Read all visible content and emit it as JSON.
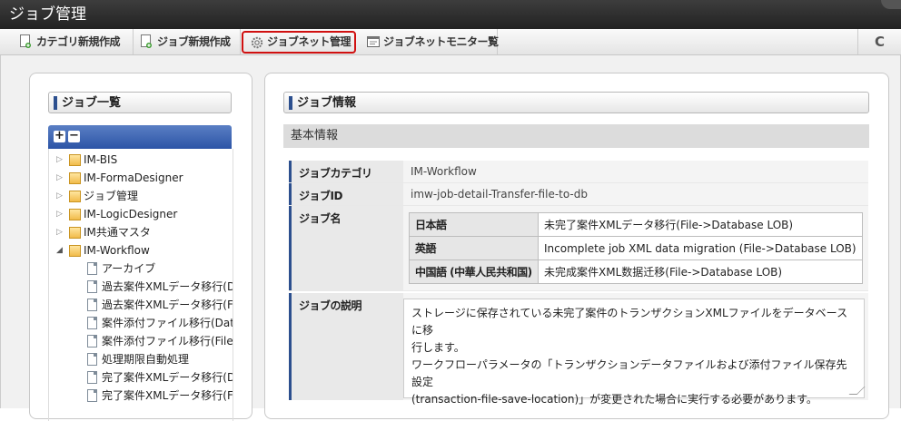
{
  "window": {
    "title": "ジョブ管理"
  },
  "toolbar": {
    "buttons": [
      {
        "label": "カテゴリ新規作成",
        "icon": "document-add-icon"
      },
      {
        "label": "ジョブ新規作成",
        "icon": "document-add-icon"
      },
      {
        "label": "ジョブネット管理",
        "icon": "gear-icon"
      },
      {
        "label": "ジョブネットモニター覧",
        "icon": "monitor-icon"
      }
    ],
    "refresh_icon": "C"
  },
  "job_list": {
    "heading": "ジョブ一覧",
    "expand_label": "+",
    "collapse_label": "−",
    "tree": [
      {
        "label": "IM-BIS",
        "type": "folder",
        "expanded": false
      },
      {
        "label": "IM-FormaDesigner",
        "type": "folder",
        "expanded": false
      },
      {
        "label": "ジョブ管理",
        "type": "folder",
        "expanded": false
      },
      {
        "label": "IM-LogicDesigner",
        "type": "folder",
        "expanded": false
      },
      {
        "label": "IM共通マスタ",
        "type": "folder",
        "expanded": false
      },
      {
        "label": "IM-Workflow",
        "type": "folder",
        "expanded": true
      },
      {
        "label": "アーカイブ",
        "type": "job"
      },
      {
        "label": "過去案件XMLデータ移行(D",
        "type": "job"
      },
      {
        "label": "過去案件XMLデータ移行(F",
        "type": "job"
      },
      {
        "label": "案件添付ファイル移行(Data",
        "type": "job"
      },
      {
        "label": "案件添付ファイル移行(File-",
        "type": "job"
      },
      {
        "label": "処理期限自動処理",
        "type": "job"
      },
      {
        "label": "完了案件XMLデータ移行(D",
        "type": "job"
      },
      {
        "label": "完了案件XMLデータ移行(F",
        "type": "job"
      }
    ]
  },
  "job_info": {
    "heading": "ジョブ情報",
    "subheading": "基本情報",
    "category_label": "ジョブカテゴリ",
    "category_value": "IM-Workflow",
    "id_label": "ジョブID",
    "id_value": "imw-job-detail-Transfer-file-to-db",
    "name_label": "ジョブ名",
    "names": [
      {
        "lang": "日本語",
        "value": "未完了案件XMLデータ移行(File->Database LOB)"
      },
      {
        "lang": "英語",
        "value": "Incomplete job XML data migration (File->Database LOB)"
      },
      {
        "lang": "中国語 (中華人民共和国)",
        "value": "未完成案件XML数据迁移(File->Database LOB)"
      }
    ],
    "description_label": "ジョブの説明",
    "description_lines": [
      "ストレージに保存されている未完了案件のトランザクションXMLファイルをデータベースに移",
      "行します。",
      "ワークフローパラメータの「トランザクションデータファイルおよび添付ファイル保存先設定",
      "(transaction-file-save-location)」が変更された場合に実行する必要があります。"
    ]
  }
}
